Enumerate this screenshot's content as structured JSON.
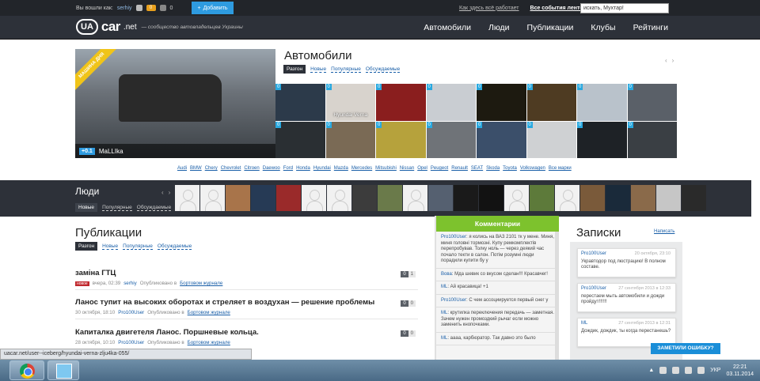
{
  "topbar": {
    "logged_as": "Вы вошли как:",
    "username": "serhiy",
    "count1": "0",
    "count2": "0",
    "add_label": "Добавить",
    "link_how": "Как здесь всё работает",
    "link_events": "Все события лентой",
    "search_value": "искать, Мухтар!"
  },
  "header": {
    "logo_ua": "UA",
    "logo_car": "car",
    "logo_net": ".net",
    "tagline": "— сообщество автовладельцев Украины",
    "nav": [
      "Автомобили",
      "Люди",
      "Публикации",
      "Клубы",
      "Рейтинги"
    ]
  },
  "cars": {
    "title": "Автомобили",
    "tabs": [
      "Разгон",
      "Новые",
      "Популярные",
      "Обсуждаемые"
    ],
    "featured_ribbon": "МАШИНА ДНЯ",
    "featured_score": "+0.1",
    "featured_name": "MaLLIka",
    "grid": [
      {
        "n": "0",
        "color": "#2c3a4a",
        "label": ""
      },
      {
        "n": "0",
        "color": "#d8d3cd",
        "label": "Hyundai Verna"
      },
      {
        "n": "0",
        "color": "#8a1e1e",
        "label": ""
      },
      {
        "n": "0",
        "color": "#c9cdd2",
        "label": ""
      },
      {
        "n": "0",
        "color": "#1d1a10",
        "label": ""
      },
      {
        "n": "0",
        "color": "#4e3b22",
        "label": ""
      },
      {
        "n": "0",
        "color": "#b9c2cb",
        "label": ""
      },
      {
        "n": "0",
        "color": "#5a6068",
        "label": ""
      },
      {
        "n": "0",
        "color": "#2a2f33",
        "label": ""
      },
      {
        "n": "0",
        "color": "#7a6a55",
        "label": ""
      },
      {
        "n": "0",
        "color": "#b6a23c",
        "label": ""
      },
      {
        "n": "0",
        "color": "#6f7378",
        "label": ""
      },
      {
        "n": "0",
        "color": "#3b4f6a",
        "label": ""
      },
      {
        "n": "0",
        "color": "#cfd1d3",
        "label": ""
      },
      {
        "n": "0",
        "color": "#1e2226",
        "label": ""
      },
      {
        "n": "0",
        "color": "#3a3f44",
        "label": ""
      }
    ],
    "brands": [
      "Audi",
      "BMW",
      "Chery",
      "Chevrolet",
      "Citroen",
      "Daewoo",
      "Ford",
      "Honda",
      "Hyundai",
      "Mazda",
      "Mercedes",
      "Mitsubishi",
      "Nissan",
      "Opel",
      "Peugeot",
      "Renault",
      "SEAT",
      "Skoda",
      "Toyota",
      "Volkswagen",
      "Все марки"
    ]
  },
  "people": {
    "title": "Люди",
    "tabs": [
      "Новые",
      "Популярные",
      "Обсуждаемые"
    ],
    "avatars": [
      "blank",
      "blank",
      "#a8744a",
      "#263a55",
      "#9a2a2a",
      "blank",
      "blank",
      "#3c3c3c",
      "#6a7a4a",
      "blank",
      "#556070",
      "#1a1a1a",
      "#121212",
      "blank",
      "#5d7a3a",
      "blank",
      "#7a5a3a",
      "#1a2a3a",
      "#8a6a4a",
      "#c6c6c6",
      "#2a2a2a"
    ]
  },
  "pubs": {
    "title": "Публикации",
    "tabs": [
      "Разгон",
      "Новые",
      "Популярные",
      "Обсуждаемые"
    ],
    "items": [
      {
        "title": "заміна ГТЦ",
        "new": "новое",
        "date": "вчера, 02:39",
        "user": "serhiy",
        "pub": "Опубликовано в",
        "journal": "Бортовом журнале",
        "c1": "0",
        "c2": "1"
      },
      {
        "title": "Ланос тупит на высоких оборотах и стреляет в воздухан — решение проблемы",
        "new": "",
        "date": "30 октября, 18:10",
        "user": "Pro100User",
        "pub": "Опубликовано в",
        "journal": "Бортовом журнале",
        "c1": "0",
        "c2": "0"
      },
      {
        "title": "Капиталка двигетеля Ланос. Поршневые кольца.",
        "new": "",
        "date": "28 октября, 10:10",
        "user": "Pro100User",
        "pub": "Опубликовано в",
        "journal": "Бортовом журнале",
        "c1": "0",
        "c2": "0"
      }
    ]
  },
  "comments": {
    "title": "Комментарии",
    "items": [
      {
        "user": "Pro100User",
        "text": ": я колись на ВАЗ 2101 тк у мене. Миня, миня головні тормозні. Купу ремкомплектів перепробував. Толку ноль — через деякий час почало текти в салон. Потім розумні люди порадили купити бу у"
      },
      {
        "user": "Вова",
        "text": ": Мда шевик со вкусом сделан!!! Красавчег!"
      },
      {
        "user": "ML",
        "text": ": Ай красавица! +1"
      },
      {
        "user": "Pro100User",
        "text": ": С чем ассоциируется первый снег у"
      },
      {
        "user": "ML",
        "text": ": крутилка переключения передачь — заметная. Зачем нужен промоздкий рычаг если можно заменить кнопочками."
      },
      {
        "user": "ML",
        "text": ": аааа, карбюратор. Так давно это было"
      }
    ]
  },
  "notes": {
    "title": "Записки",
    "add": "Написать",
    "items": [
      {
        "user": "Pro100User",
        "date": "20 октября, 23:10",
        "text": "Укравтодор под люстрацию! В полном составе."
      },
      {
        "user": "Pro100User",
        "date": "27 сентября 2013 в 12:33",
        "text": "перестаем мыть автомобили и дожди пройдут!!!!!!"
      },
      {
        "user": "ML",
        "date": "27 сентября 2013 в 12:31",
        "text": "Дождик, дождик, ты когда перестанешь?"
      }
    ]
  },
  "error_button": "ЗАМЕТИЛИ ОШИБКУ?",
  "status_url": "uacar.net/user--iceberg/hyundai-verna-zlju4ka-055/",
  "taskbar": {
    "lang": "УКР",
    "time": "22:21",
    "date": "03.11.2014"
  }
}
